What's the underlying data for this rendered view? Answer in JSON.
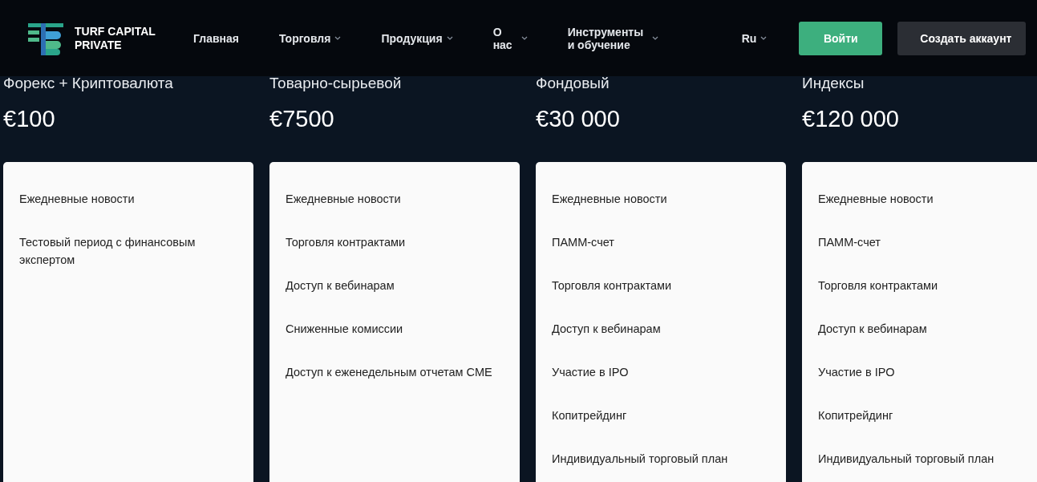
{
  "header": {
    "logo": {
      "line_1": "TURF CAPITAL",
      "line_2": "PRIVATE"
    },
    "nav": [
      {
        "label": "Главная",
        "dropdown": false
      },
      {
        "label": "Торговля",
        "dropdown": true
      },
      {
        "label": "Продукция",
        "dropdown": true
      },
      {
        "label": "О нас",
        "dropdown": true
      },
      {
        "label": "Инструменты и обучение",
        "dropdown": true
      }
    ],
    "language": {
      "label": "Ru",
      "dropdown": true
    },
    "login_button": "Войти",
    "signup_button": "Создать аккаунт"
  },
  "plans": [
    {
      "title": "Форекс + Криптовалюта",
      "price": "€100",
      "features": [
        "Ежедневные новости",
        "Тестовый период с финансовым экспертом"
      ]
    },
    {
      "title": "Товарно-сырьевой",
      "price": "€7500",
      "features": [
        "Ежедневные новости",
        "Торговля контрактами",
        "Доступ к вебинарам",
        "Сниженные комиссии",
        "Доступ к еженедельным отчетам CME"
      ]
    },
    {
      "title": "Фондовый",
      "price": "€30 000",
      "features": [
        "Ежедневные новости",
        "ПАММ-счет",
        "Торговля контрактами",
        "Доступ к вебинарам",
        "Участие в IPO",
        "Копитрейдинг",
        "Индивидуальный торговый план"
      ]
    },
    {
      "title": "Индексы",
      "price": "€120 000",
      "features": [
        "Ежедневные новости",
        "ПАММ-счет",
        "Торговля контрактами",
        "Доступ к вебинарам",
        "Участие в IPO",
        "Копитрейдинг",
        "Индивидуальный торговый план"
      ]
    }
  ]
}
